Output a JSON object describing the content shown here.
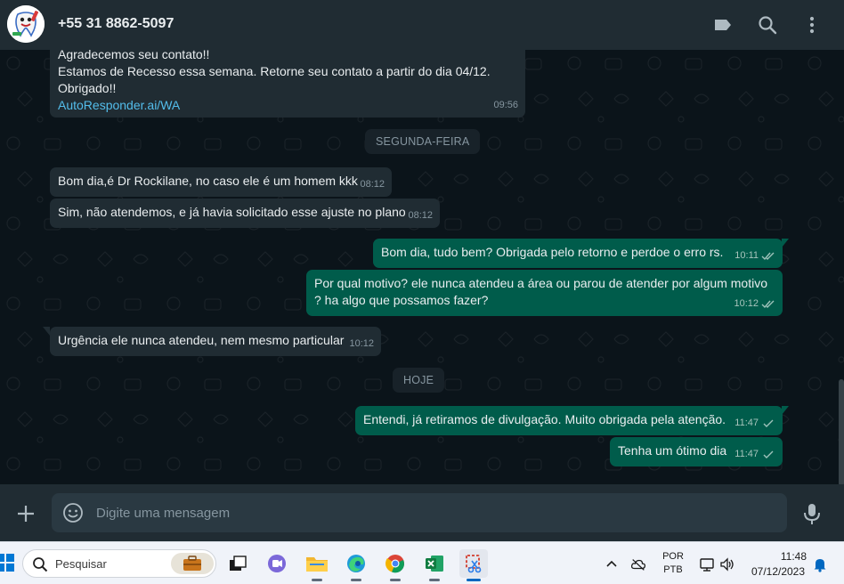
{
  "header": {
    "contact_name": "+55 31 8862-5097",
    "icons": [
      "label-icon",
      "search-icon",
      "menu-icon"
    ]
  },
  "messages": [
    {
      "direction": "in",
      "lines": [
        "Agradecemos seu contato!!",
        "Estamos de Recesso essa semana. Retorne seu contato a partir do dia 04/12.",
        "Obrigado!!"
      ],
      "link": "AutoResponder.ai/WA",
      "time": "09:56"
    },
    {
      "type": "date",
      "label": "SEGUNDA-FEIRA"
    },
    {
      "direction": "in",
      "text": "Bom dia,é Dr Rockilane, no caso ele é um homem kkk",
      "time": "08:12"
    },
    {
      "direction": "in",
      "text": "Sim, não atendemos, e já havia solicitado esse ajuste no plano",
      "time": "08:12"
    },
    {
      "direction": "out",
      "text": "Bom dia, tudo bem? Obrigada pelo retorno e perdoe o erro rs.",
      "time": "10:11",
      "status": "read"
    },
    {
      "direction": "out",
      "lines": [
        "Por qual motivo? ele nunca atendeu a área ou parou de atender por algum motivo",
        "? ha algo que possamos fazer?"
      ],
      "time": "10:12",
      "status": "read"
    },
    {
      "direction": "in",
      "text": "Urgência ele nunca atendeu, nem mesmo particular",
      "time": "10:12"
    },
    {
      "type": "date",
      "label": "HOJE"
    },
    {
      "direction": "out",
      "text": "Entendi, já retiramos de divulgação. Muito obrigada pela atenção.",
      "time": "11:47",
      "status": "sent"
    },
    {
      "direction": "out",
      "text": "Tenha um ótimo dia",
      "time": "11:47",
      "status": "sent"
    }
  ],
  "composer": {
    "placeholder": "Digite uma mensagem",
    "value": ""
  },
  "taskbar": {
    "search_placeholder": "Pesquisar",
    "apps": [
      "task-view",
      "teams-chat",
      "file-explorer",
      "edge",
      "chrome",
      "excel",
      "snipping-tool"
    ],
    "language_top": "POR",
    "language_bottom": "PTB",
    "clock_time": "11:48",
    "clock_date": "07/12/2023"
  },
  "colors": {
    "header_bg": "#202c33",
    "chat_bg": "#0b141a",
    "bubble_in": "#202c33",
    "bubble_out": "#005c4b",
    "link": "#53bdeb",
    "read_tick": "#53bdeb"
  }
}
